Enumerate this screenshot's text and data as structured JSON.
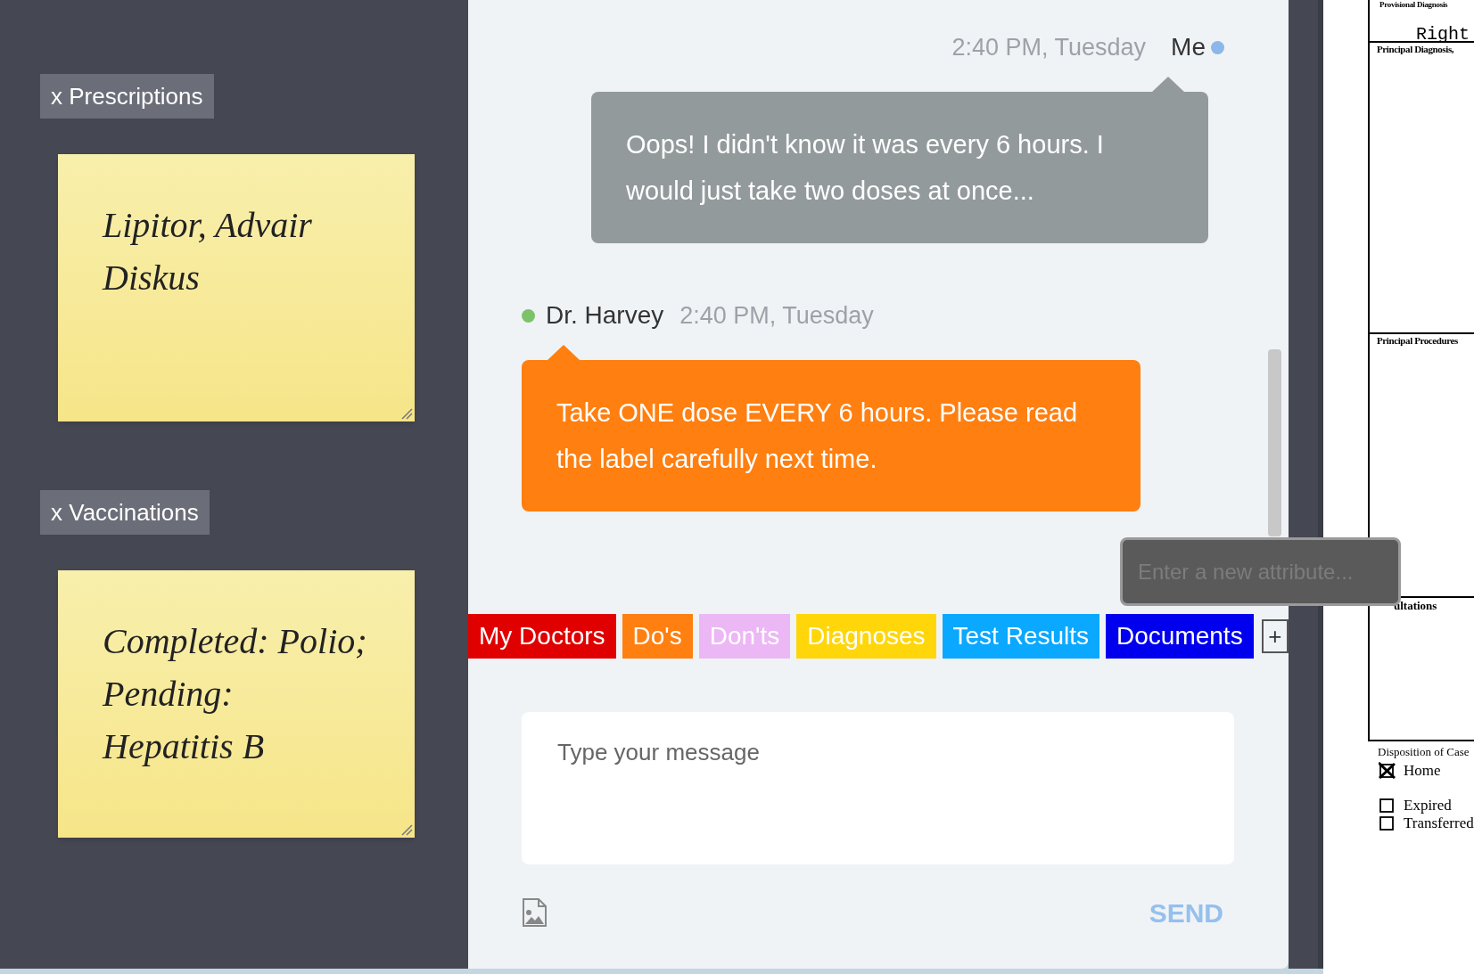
{
  "sidebar": {
    "notes": [
      {
        "label": "x Prescriptions",
        "text": "Lipitor, Advair Diskus"
      },
      {
        "label": "x Vaccinations",
        "text": "Completed: Polio;\nPending:\nHepatitis B"
      }
    ]
  },
  "chat": {
    "messages": [
      {
        "kind": "outgoing",
        "sender": "Me",
        "time": "2:40 PM, Tuesday",
        "color": "#8bb8e8",
        "text": "Oops! I didn't know it was every 6 hours. I would just take two doses at once..."
      },
      {
        "kind": "incoming",
        "sender": "Dr. Harvey",
        "time": "2:40 PM, Tuesday",
        "color": "#7cc26b",
        "text": "Take ONE dose EVERY 6 hours. Please read the label carefully next time."
      }
    ],
    "attribute_field": {
      "placeholder": "Enter a new attribute..."
    },
    "tags": [
      {
        "label": "My Doctors",
        "color": "#e00000"
      },
      {
        "label": "Do's",
        "color": "#ff7f10"
      },
      {
        "label": "Don'ts",
        "color": "#ecb7f5"
      },
      {
        "label": "Diagnoses",
        "color": "#ffd60a"
      },
      {
        "label": "Test Results",
        "color": "#0aa8ff"
      },
      {
        "label": "Documents",
        "color": "#0000ee"
      }
    ],
    "add_tag": "+",
    "composer": {
      "placeholder": "Type your message",
      "send": "SEND"
    }
  },
  "document": {
    "provisional": "Provisional Diagnosis",
    "right": "Right",
    "principal_diagnosis": "Principal Diagnosis,",
    "principal_procedures": "Principal Procedures",
    "consultations": "ultations",
    "disposition": "Disposition of Case",
    "options": [
      {
        "label": "Home",
        "checked": true
      },
      {
        "label": "Expired",
        "checked": false
      },
      {
        "label": "Transferred",
        "checked": false
      }
    ]
  }
}
